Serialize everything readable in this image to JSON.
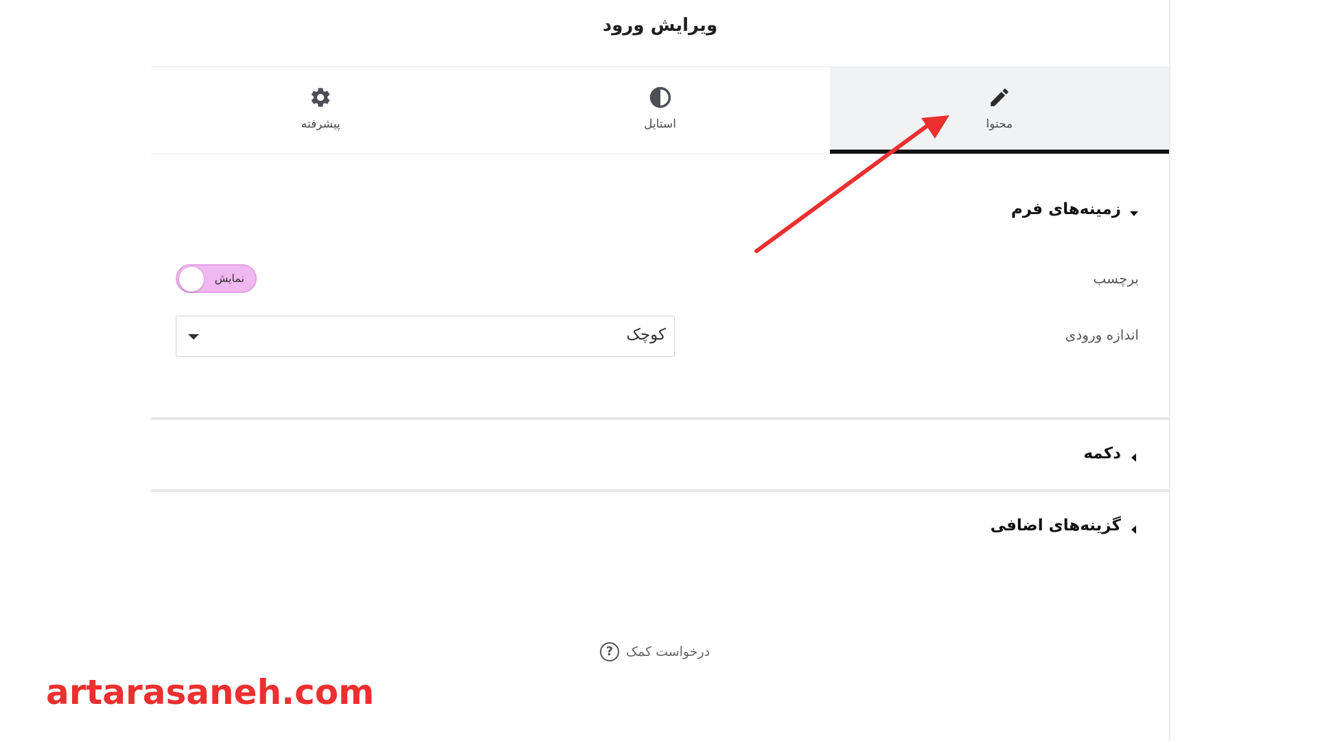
{
  "panel": {
    "title": "ویرایش ورود"
  },
  "tabs": [
    {
      "label": "محتوا",
      "icon": "pencil-icon",
      "active": true
    },
    {
      "label": "استایل",
      "icon": "contrast-icon",
      "active": false
    },
    {
      "label": "پیشرفته",
      "icon": "gear-icon",
      "active": false
    }
  ],
  "sections": {
    "form_fields": {
      "title": "زمینه‌های فرم",
      "expanded": true,
      "label_field": {
        "label": "برچسب",
        "toggle_text": "نمایش",
        "toggle_on": true
      },
      "input_size": {
        "label": "اندازه ورودی",
        "value": "کوچک"
      }
    },
    "button": {
      "title": "دکمه",
      "expanded": false
    },
    "extra_options": {
      "title": "گزینه‌های اضافی",
      "expanded": false
    }
  },
  "help": {
    "label": "درخواست کمک",
    "icon": "question-icon"
  },
  "watermark": "artarasaneh.com",
  "colors": {
    "toggle": "#f0b8f0",
    "active_tab_bg": "#f1f2f3",
    "arrow": "#ec2f2f",
    "watermark": "#ec2f2f"
  }
}
